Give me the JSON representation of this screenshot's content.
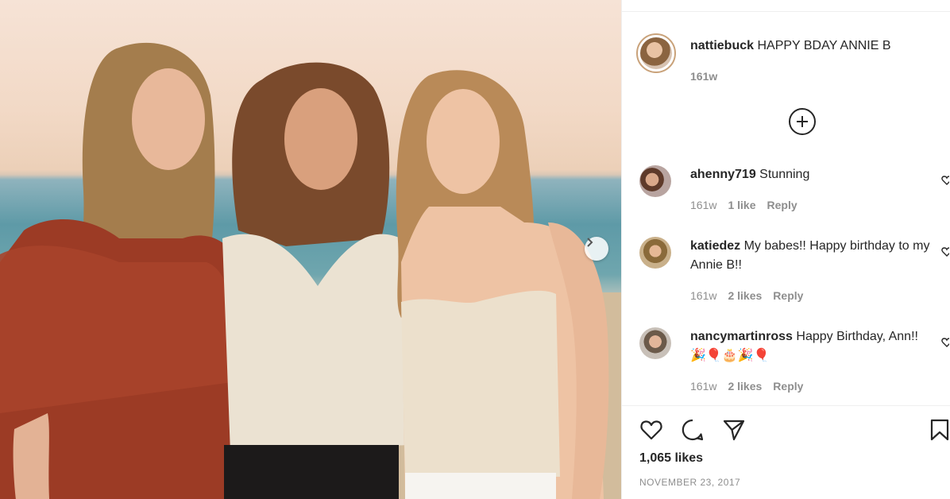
{
  "post": {
    "author": "nattiebuck",
    "caption": "HAPPY BDAY ANNIE B",
    "age": "161w"
  },
  "comments": [
    {
      "user": "ahenny719",
      "text": "Stunning",
      "age": "161w",
      "likes": "1 like",
      "reply": "Reply"
    },
    {
      "user": "katiedez",
      "text": "My babes!! Happy birthday to my Annie B!!",
      "age": "161w",
      "likes": "2 likes",
      "reply": "Reply"
    },
    {
      "user": "nancymartinross",
      "text": "Happy Birthday, Ann!! 🎉🎈🎂🎉🎈",
      "age": "161w",
      "likes": "2 likes",
      "reply": "Reply"
    }
  ],
  "footer": {
    "likes": "1,065 likes",
    "date": "NOVEMBER 23, 2017"
  },
  "icons": {
    "load_more": "plus-circle-icon",
    "like": "heart-icon",
    "comment": "comment-bubble-icon",
    "share": "paper-plane-icon",
    "save": "bookmark-icon",
    "next": "chevron-right-icon"
  }
}
